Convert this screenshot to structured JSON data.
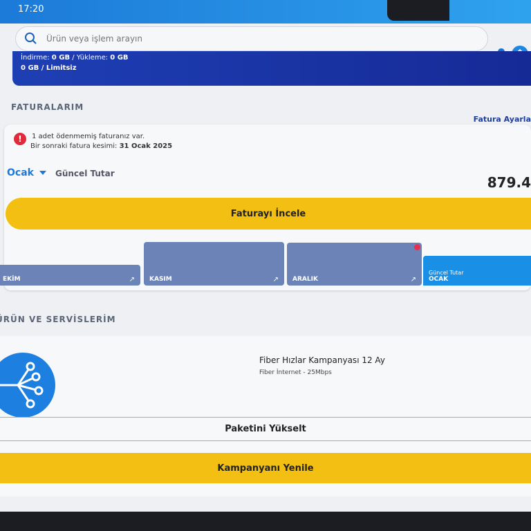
{
  "status_bar": {
    "time": "17:20"
  },
  "search": {
    "placeholder": "Ürün veya işlem arayın"
  },
  "icons": {
    "search": "search-icon",
    "bell": "bell-icon",
    "home": "home-icon",
    "alert": "alert-icon",
    "fiber": "fiber-network-icon"
  },
  "usage": {
    "line1_prefix": "İndirme: ",
    "download": "0 GB",
    "line1_mid": " / Yükleme: ",
    "upload": "0 GB",
    "line2": "0 GB / Limitsiz"
  },
  "bills": {
    "section_title": "FATURALARIM",
    "settings_link": "Fatura Ayarla",
    "alert_line1": "1 adet ödenmemiş faturanız var.",
    "alert_line2_prefix": "Bir sonraki fatura kesimi: ",
    "next_cut_date": "31 Ocak 2025",
    "selected_month": "Ocak",
    "current_amount_label": "Güncel Tutar",
    "amount": "879.4",
    "review_button": "Faturayı İncele",
    "months": [
      {
        "label": "EKİM"
      },
      {
        "label": "KASIM"
      },
      {
        "label": "ARALIK",
        "unpaid": true
      }
    ],
    "active_month": {
      "sub": "Güncel Tutar",
      "label": "OCAK"
    },
    "colors": {
      "accent_yellow": "#f2bf12",
      "blue": "#1a8fe6",
      "tab": "#6c83b8",
      "alert": "#e02b3a"
    }
  },
  "products": {
    "section_title": "ÜRÜN VE SERVİSLERİM",
    "name": "Fiber Hızlar Kampanyası 12 Ay",
    "detail": "Fiber İnternet - 25Mbps",
    "upgrade_button": "Paketini Yükselt",
    "renew_button": "Kampanyanı Yenile"
  }
}
